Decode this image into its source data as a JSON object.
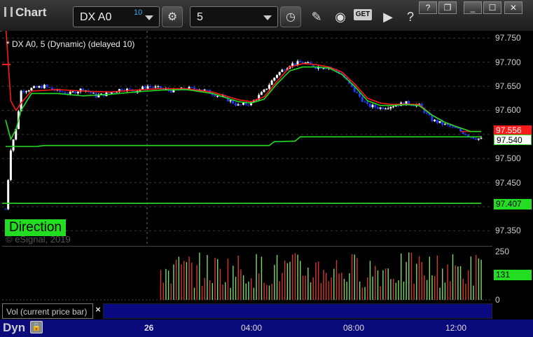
{
  "toolbar": {
    "title": "Chart",
    "symbol": "DX A0",
    "symbol_badge": "10",
    "interval": "5",
    "icons": [
      "settings-gear-icon",
      "clock-icon",
      "pencil-icon",
      "study-icon",
      "get-icon",
      "play-icon",
      "help-icon",
      "restore-icon",
      "minimize-icon",
      "maximize-icon",
      "close-icon"
    ],
    "get_label": "GET",
    "win_help": "?"
  },
  "chart": {
    "info": "* DX A0, 5 (Dynamic) (delayed 10)",
    "copyright": "© eSignal, 2019",
    "direction_label": "Direction",
    "price_ticks": [
      "97.750",
      "97.700",
      "97.650",
      "97.600",
      "97.550",
      "97.500",
      "97.450",
      "97.400",
      "97.350"
    ],
    "vol_ticks": [
      "250",
      "0"
    ],
    "labels": {
      "red": "97.556",
      "white": "97.540",
      "green_low": "97.407",
      "vol": "131"
    },
    "vol_study_label": "Vol (current price bar)",
    "close_glyph": "×",
    "time_labels": [
      "26",
      "04:00",
      "08:00",
      "12:00"
    ],
    "dyn_label": "Dyn",
    "colors": {
      "up_candle": "#ffffff",
      "down_candle": "#1a3cff",
      "red_ma": "#ff1a1a",
      "green_ma": "#22dd22",
      "time_bar": "#0a0a7a"
    }
  },
  "chart_data": {
    "type": "candlestick",
    "y_range": [
      97.32,
      97.765
    ],
    "price_close_path": [
      [
        0,
        97.395
      ],
      [
        2,
        97.52
      ],
      [
        4,
        97.56
      ],
      [
        6,
        97.64
      ],
      [
        10,
        97.645
      ],
      [
        15,
        97.65
      ],
      [
        20,
        97.64
      ],
      [
        25,
        97.635
      ],
      [
        30,
        97.645
      ],
      [
        35,
        97.63
      ],
      [
        40,
        97.635
      ],
      [
        45,
        97.645
      ],
      [
        50,
        97.64
      ],
      [
        55,
        97.65
      ],
      [
        60,
        97.645
      ],
      [
        65,
        97.64
      ],
      [
        70,
        97.645
      ],
      [
        75,
        97.645
      ],
      [
        80,
        97.635
      ],
      [
        85,
        97.625
      ],
      [
        90,
        97.61
      ],
      [
        95,
        97.615
      ],
      [
        100,
        97.64
      ],
      [
        105,
        97.675
      ],
      [
        110,
        97.695
      ],
      [
        115,
        97.7
      ],
      [
        120,
        97.69
      ],
      [
        125,
        97.69
      ],
      [
        130,
        97.675
      ],
      [
        135,
        97.64
      ],
      [
        140,
        97.61
      ],
      [
        145,
        97.605
      ],
      [
        150,
        97.61
      ],
      [
        155,
        97.615
      ],
      [
        160,
        97.61
      ],
      [
        165,
        97.58
      ],
      [
        170,
        97.57
      ],
      [
        175,
        97.56
      ],
      [
        180,
        97.545
      ],
      [
        184,
        97.54
      ]
    ],
    "red_ma_path": [
      [
        0,
        97.78
      ],
      [
        2,
        97.62
      ],
      [
        4,
        97.6
      ],
      [
        6,
        97.615
      ],
      [
        10,
        97.64
      ],
      [
        20,
        97.643
      ],
      [
        30,
        97.64
      ],
      [
        40,
        97.638
      ],
      [
        50,
        97.642
      ],
      [
        60,
        97.645
      ],
      [
        70,
        97.645
      ],
      [
        80,
        97.638
      ],
      [
        90,
        97.622
      ],
      [
        95,
        97.618
      ],
      [
        100,
        97.628
      ],
      [
        105,
        97.66
      ],
      [
        110,
        97.69
      ],
      [
        115,
        97.697
      ],
      [
        120,
        97.695
      ],
      [
        125,
        97.69
      ],
      [
        130,
        97.68
      ],
      [
        135,
        97.655
      ],
      [
        140,
        97.625
      ],
      [
        145,
        97.615
      ],
      [
        150,
        97.612
      ],
      [
        155,
        97.613
      ],
      [
        160,
        97.612
      ],
      [
        165,
        97.59
      ],
      [
        170,
        97.575
      ],
      [
        175,
        97.565
      ],
      [
        180,
        97.556
      ],
      [
        184,
        97.556
      ]
    ],
    "green_ma_path": [
      [
        0,
        97.58
      ],
      [
        2,
        97.54
      ],
      [
        4,
        97.56
      ],
      [
        6,
        97.6
      ],
      [
        10,
        97.635
      ],
      [
        20,
        97.635
      ],
      [
        30,
        97.63
      ],
      [
        40,
        97.633
      ],
      [
        50,
        97.638
      ],
      [
        60,
        97.642
      ],
      [
        70,
        97.643
      ],
      [
        80,
        97.635
      ],
      [
        90,
        97.618
      ],
      [
        95,
        97.615
      ],
      [
        100,
        97.623
      ],
      [
        105,
        97.655
      ],
      [
        110,
        97.682
      ],
      [
        115,
        97.69
      ],
      [
        120,
        97.69
      ],
      [
        125,
        97.688
      ],
      [
        130,
        97.675
      ],
      [
        135,
        97.65
      ],
      [
        140,
        97.62
      ],
      [
        145,
        97.61
      ],
      [
        150,
        97.61
      ],
      [
        155,
        97.612
      ],
      [
        160,
        97.61
      ],
      [
        165,
        97.59
      ],
      [
        170,
        97.575
      ],
      [
        175,
        97.565
      ],
      [
        180,
        97.556
      ],
      [
        184,
        97.556
      ]
    ],
    "green_band_upper": [
      [
        0,
        97.525
      ],
      [
        12,
        97.525
      ],
      [
        15,
        97.527
      ],
      [
        102,
        97.527
      ],
      [
        104,
        97.535
      ],
      [
        112,
        97.536
      ],
      [
        114,
        97.545
      ],
      [
        184,
        97.545
      ]
    ],
    "green_low_level": 97.407,
    "current_price": 97.54,
    "volume_max": 250,
    "volume_current": 131
  }
}
